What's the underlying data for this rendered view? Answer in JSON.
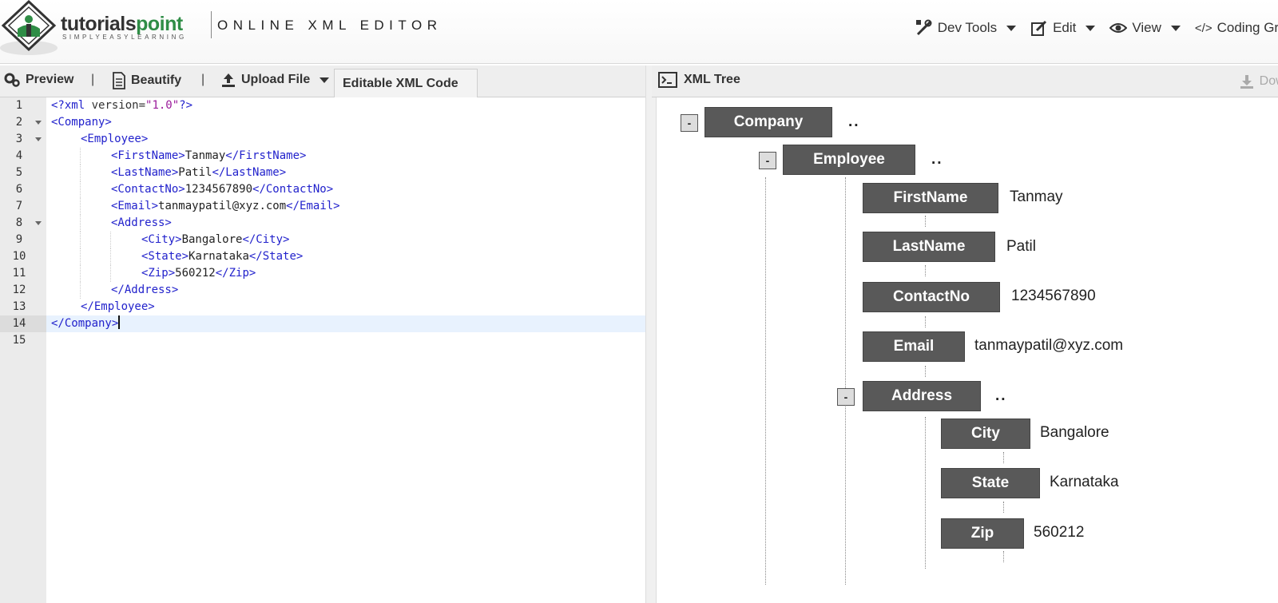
{
  "header": {
    "logo_text_main": "tutorials",
    "logo_text_accent": "point",
    "logo_tagline": "SIMPLYEASYLEARNING",
    "site_title": "ONLINE XML EDITOR",
    "nav": [
      {
        "label": "Dev Tools",
        "icon": "tools-icon"
      },
      {
        "label": "Edit",
        "icon": "edit-icon"
      },
      {
        "label": "View",
        "icon": "eye-icon"
      },
      {
        "label": "Coding Grou",
        "icon": "code-icon"
      }
    ]
  },
  "left_toolbar": {
    "preview": "Preview",
    "beautify": "Beautify",
    "upload": "Upload File",
    "separator": "|",
    "editable_tab": "Editable XML Code"
  },
  "editor": {
    "active_line": 14,
    "lines": [
      {
        "n": "1",
        "fold": false
      },
      {
        "n": "2",
        "fold": true
      },
      {
        "n": "3",
        "fold": true
      },
      {
        "n": "4",
        "fold": false
      },
      {
        "n": "5",
        "fold": false
      },
      {
        "n": "6",
        "fold": false
      },
      {
        "n": "7",
        "fold": false
      },
      {
        "n": "8",
        "fold": true
      },
      {
        "n": "9",
        "fold": false
      },
      {
        "n": "10",
        "fold": false
      },
      {
        "n": "11",
        "fold": false
      },
      {
        "n": "12",
        "fold": false
      },
      {
        "n": "13",
        "fold": false
      },
      {
        "n": "14",
        "fold": false
      },
      {
        "n": "15",
        "fold": false
      }
    ],
    "code": {
      "l1_open": "<?xml",
      "l1_attr": " version=",
      "l1_str": "\"1.0\"",
      "l1_close": "?>",
      "l2": "<Company>",
      "l3": "<Employee>",
      "l4_open": "<FirstName>",
      "l4_text": "Tanmay",
      "l4_close": "</FirstName>",
      "l5_open": "<LastName>",
      "l5_text": "Patil",
      "l5_close": "</LastName>",
      "l6_open": "<ContactNo>",
      "l6_text": "1234567890",
      "l6_close": "</ContactNo>",
      "l7_open": "<Email>",
      "l7_text": "tanmaypatil@xyz.com",
      "l7_close": "</Email>",
      "l8": "<Address>",
      "l9_open": "<City>",
      "l9_text": "Bangalore",
      "l9_close": "</City>",
      "l10_open": "<State>",
      "l10_text": "Karnataka",
      "l10_close": "</State>",
      "l11_open": "<Zip>",
      "l11_text": "560212",
      "l11_close": "</Zip>",
      "l12": "</Address>",
      "l13": "</Employee>",
      "l14": "</Company>"
    }
  },
  "right_toolbar": {
    "title": "XML Tree",
    "download": "Downlo"
  },
  "tree": {
    "toggle_label": "-",
    "ellipsis": "..",
    "company": "Company",
    "employee": "Employee",
    "firstname": {
      "name": "FirstName",
      "value": "Tanmay"
    },
    "lastname": {
      "name": "LastName",
      "value": "Patil"
    },
    "contactno": {
      "name": "ContactNo",
      "value": "1234567890"
    },
    "email": {
      "name": "Email",
      "value": "tanmaypatil@xyz.com"
    },
    "address": "Address",
    "city": {
      "name": "City",
      "value": "Bangalore"
    },
    "state": {
      "name": "State",
      "value": "Karnataka"
    },
    "zip": {
      "name": "Zip",
      "value": "560212"
    }
  }
}
